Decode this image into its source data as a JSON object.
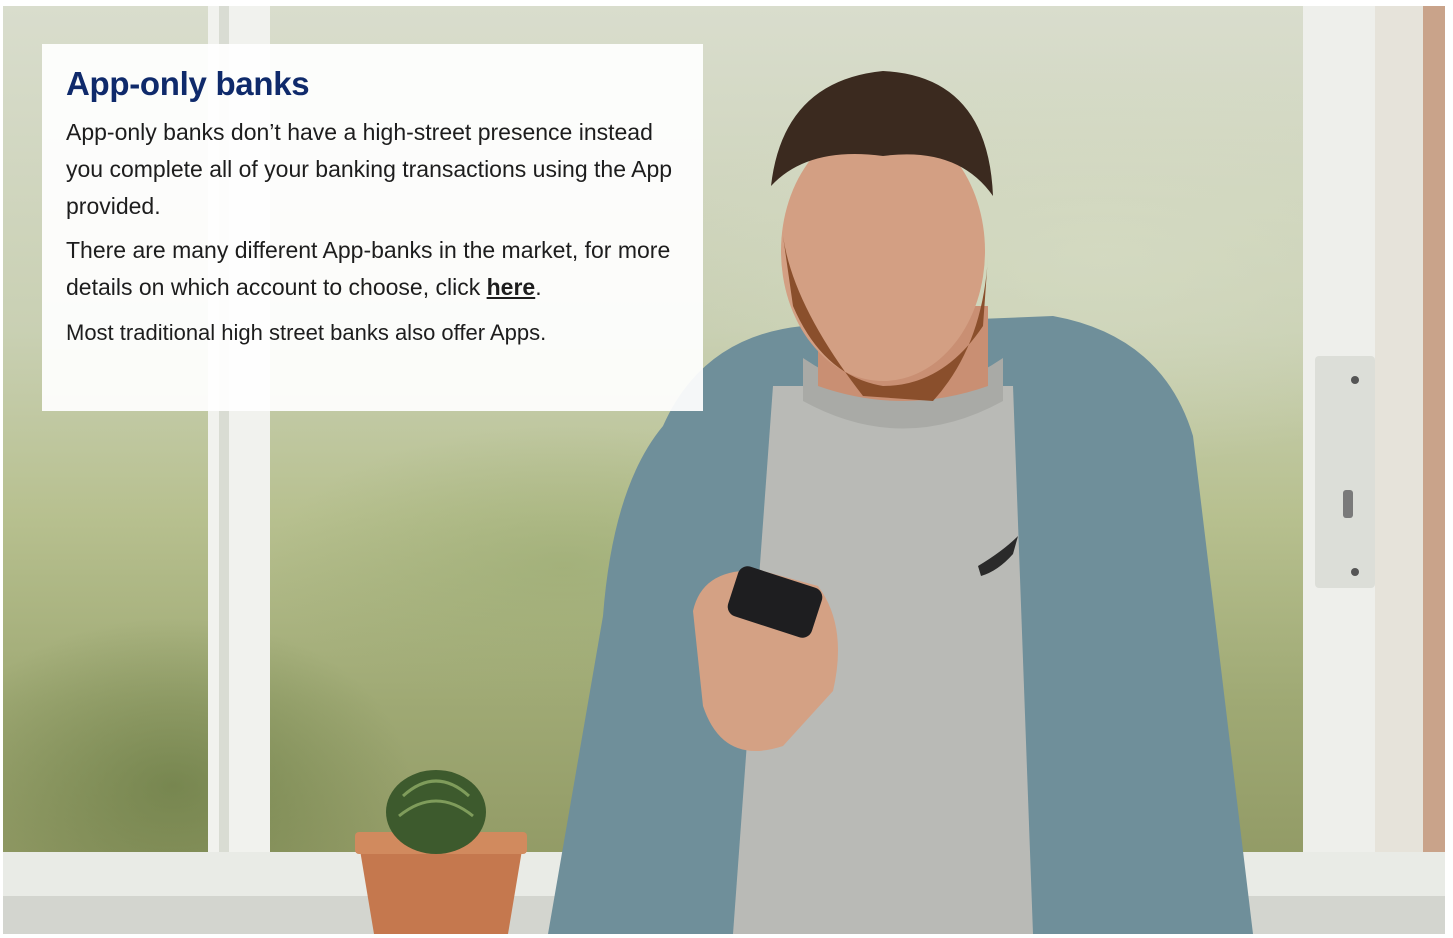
{
  "info_box": {
    "heading": "App-only banks",
    "paragraph1": "App-only banks don’t have a high-street presence instead you complete all of your banking transactions using the App provided.",
    "paragraph2_before": "There are many different App-banks in the market, for more details on which account to choose, click ",
    "paragraph2_link": "here",
    "paragraph2_after": ".",
    "paragraph3": "Most traditional high street banks also offer Apps."
  },
  "colors": {
    "heading": "#0f2a6b",
    "body_text": "#1d1d1d",
    "panel_background": "#ffffff"
  }
}
